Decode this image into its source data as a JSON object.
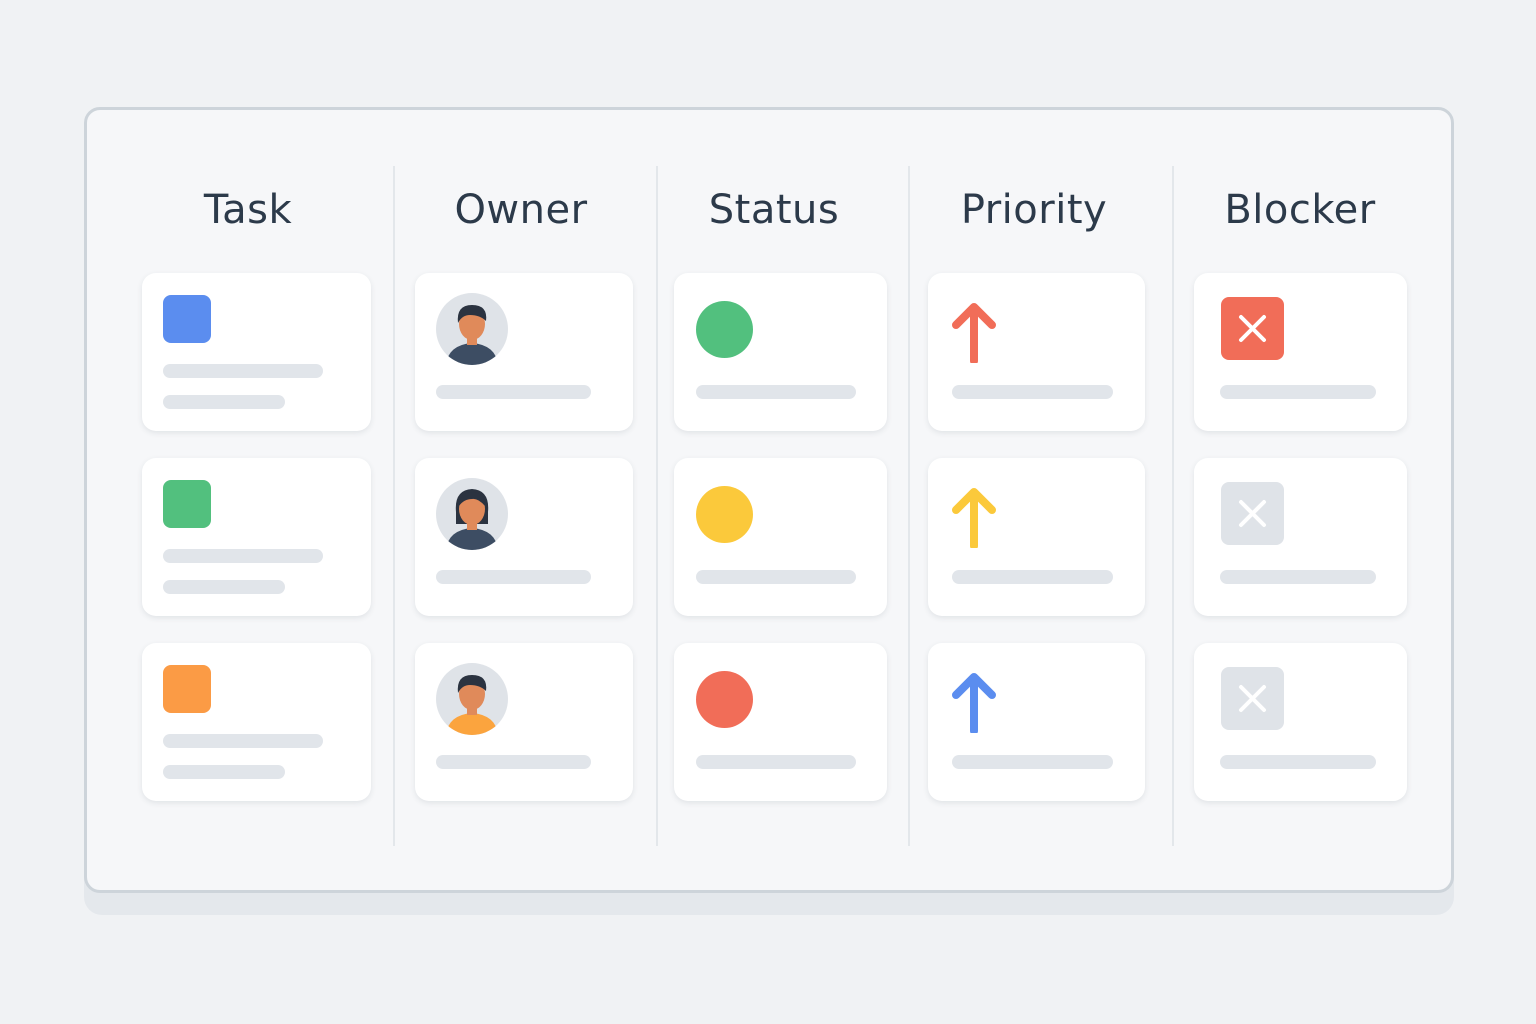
{
  "board": {
    "columns": [
      {
        "key": "task",
        "title": "Task"
      },
      {
        "key": "owner",
        "title": "Owner"
      },
      {
        "key": "status",
        "title": "Status"
      },
      {
        "key": "priority",
        "title": "Priority"
      },
      {
        "key": "blocker",
        "title": "Blocker"
      }
    ]
  },
  "rows": [
    {
      "task_color": "#5b8def",
      "owner_avatar": {
        "icon": "person-icon",
        "skin": "#e08a5a",
        "hair": "#2b3340",
        "shirt": "#3d4d63",
        "style": "short"
      },
      "status_color": "#52c07e",
      "priority": {
        "icon": "arrow-up-icon",
        "color": "#f16d58"
      },
      "blocker": {
        "icon": "close-icon",
        "active": true,
        "color": "#f16d58"
      }
    },
    {
      "task_color": "#52c07e",
      "owner_avatar": {
        "icon": "person-icon",
        "skin": "#e08a5a",
        "hair": "#2b3340",
        "shirt": "#3d4d63",
        "style": "long"
      },
      "status_color": "#fbc93b",
      "priority": {
        "icon": "arrow-up-icon",
        "color": "#fbc93b"
      },
      "blocker": {
        "icon": "close-icon",
        "active": false,
        "color": "#dfe3e8"
      }
    },
    {
      "task_color": "#fb9b45",
      "owner_avatar": {
        "icon": "person-icon",
        "skin": "#e08a5a",
        "hair": "#2b3340",
        "shirt": "#fba43e",
        "style": "short"
      },
      "status_color": "#f16d58",
      "priority": {
        "icon": "arrow-up-icon",
        "color": "#5b8def"
      },
      "blocker": {
        "icon": "close-icon",
        "active": false,
        "color": "#dfe3e8"
      }
    }
  ]
}
